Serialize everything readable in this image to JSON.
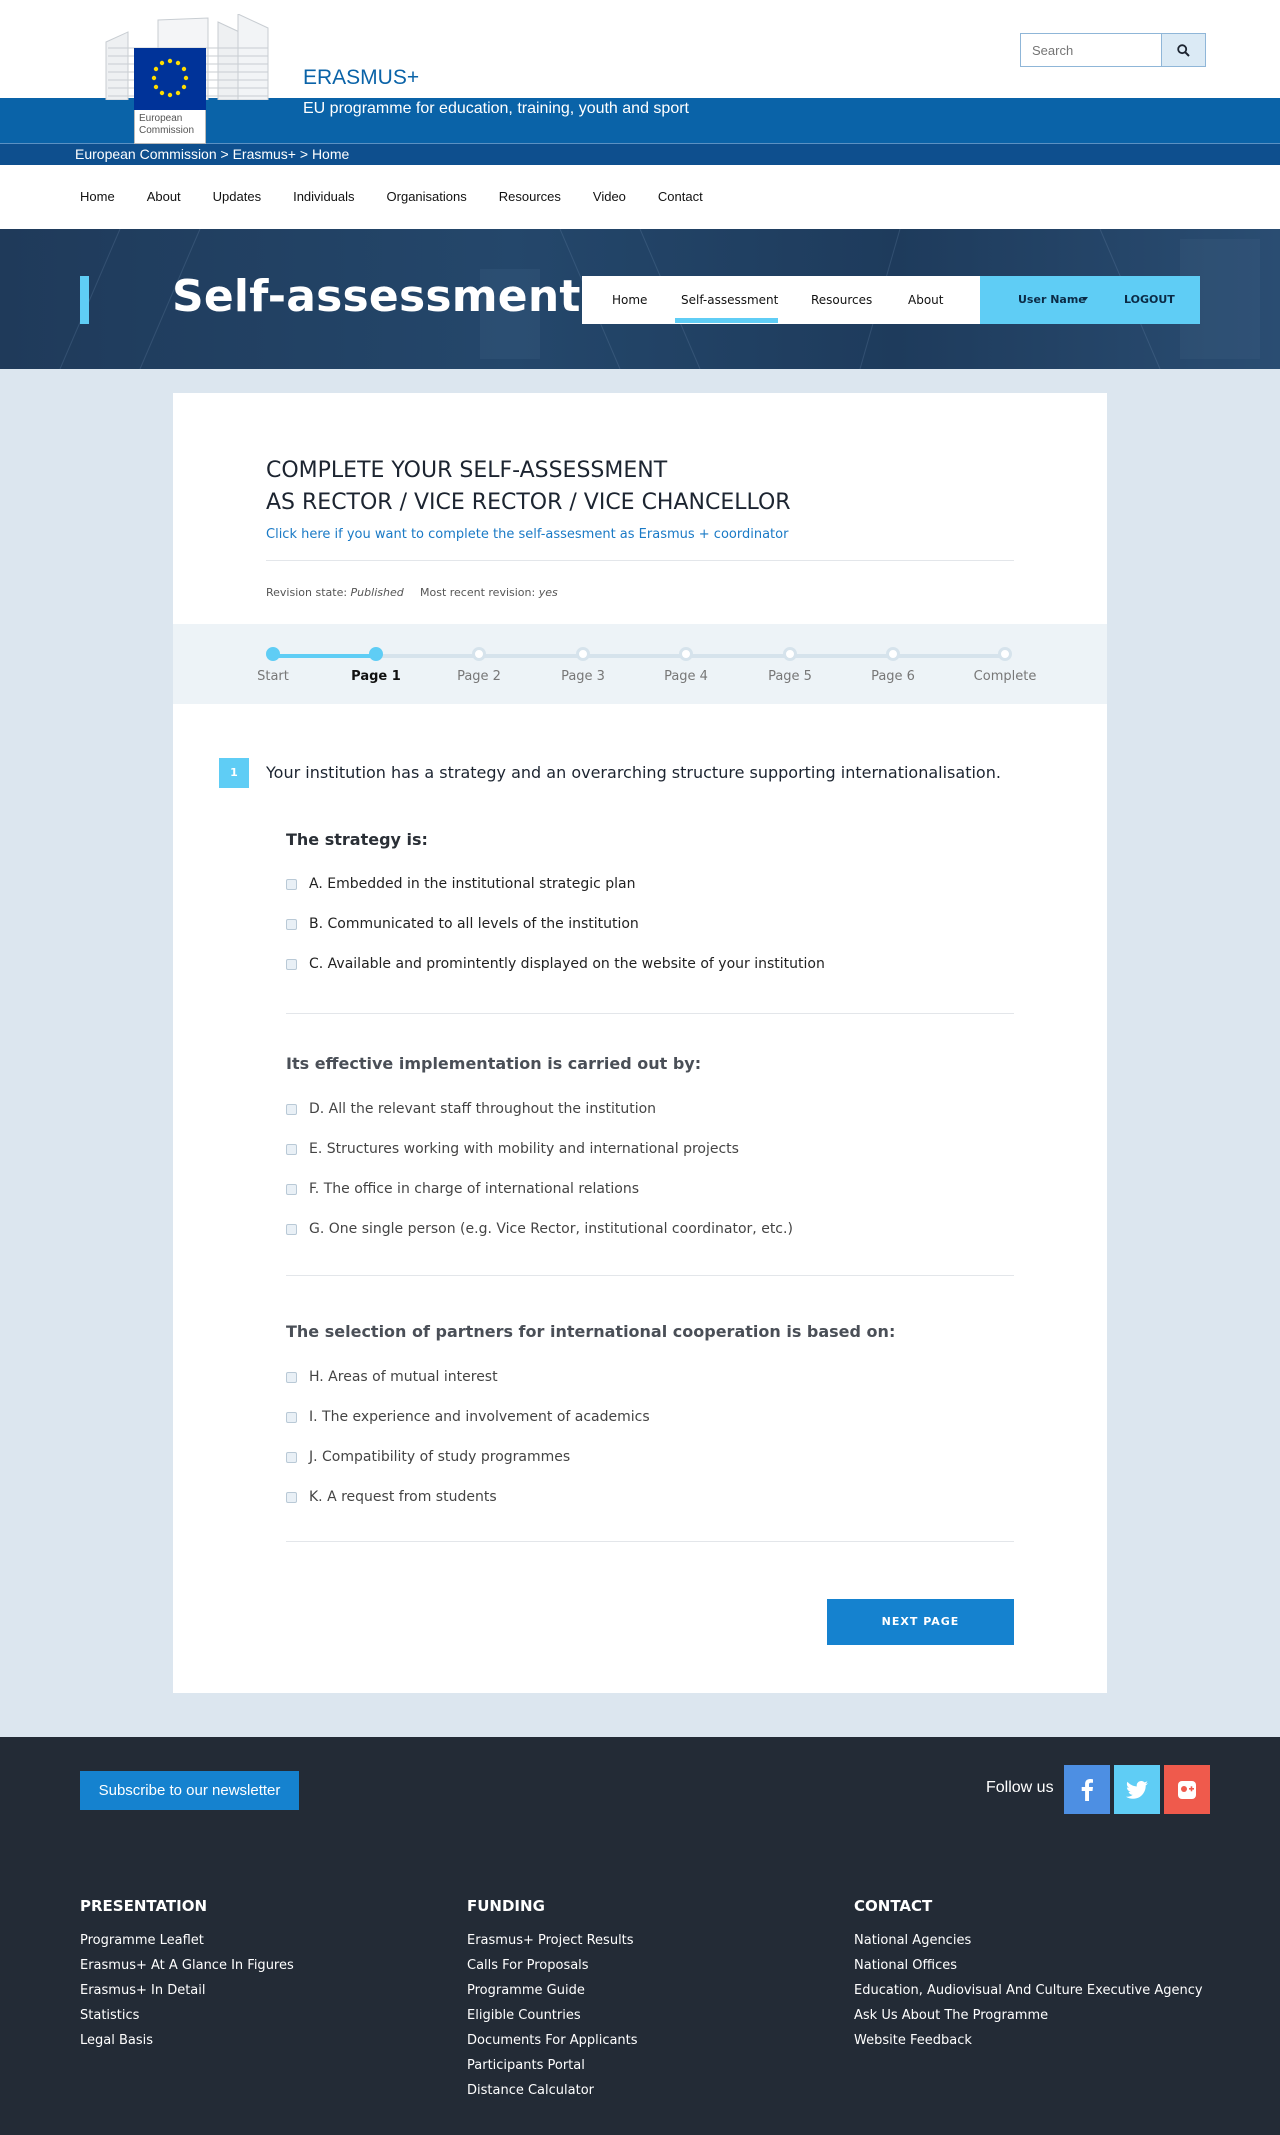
{
  "header": {
    "logo_caption": "European Commission",
    "site_title": "ERASMUS+",
    "site_subtitle": "EU programme for education, training, youth and sport",
    "breadcrumb": "European Commission > Erasmus+ > Home",
    "search_placeholder": "Search",
    "colors": {
      "brand_blue": "#0a63a8",
      "accent": "#5fcdf5"
    }
  },
  "main_nav": [
    "Home",
    "About",
    "Updates",
    "Individuals",
    "Organisations",
    "Resources",
    "Video",
    "Contact"
  ],
  "hero": {
    "title": "Self-assessment",
    "subnav": [
      "Home",
      "Self-assessment",
      "Resources",
      "About"
    ],
    "active_subnav": "Self-assessment",
    "user_name": "User Name",
    "logout": "LOGOUT"
  },
  "assessment": {
    "heading_line1": "COMPLETE YOUR SELF-ASSESSMENT",
    "heading_line2": "AS RECTOR / VICE RECTOR / VICE CHANCELLOR",
    "alt_link": "Click here if you want to complete the self-assesment as Erasmus + coordinator",
    "revision_state_label": "Revision state:",
    "revision_state_value": "Published",
    "recent_revision_label": "Most recent revision:",
    "recent_revision_value": "yes",
    "steps": [
      "Start",
      "Page 1",
      "Page 2",
      "Page 3",
      "Page 4",
      "Page 5",
      "Page 6",
      "Complete"
    ],
    "current_step": "Page 1",
    "question_number": "1",
    "question_text": "Your institution has a strategy and an overarching structure supporting internationalisation.",
    "groups": [
      {
        "title": "The strategy is:",
        "options": [
          "A. Embedded in the institutional strategic plan",
          "B. Communicated to all levels of the institution",
          "C. Available and promintently displayed on the website of your institution"
        ]
      },
      {
        "title": "Its effective implementation is carried out by:",
        "options": [
          "D. All the relevant staff throughout the institution",
          "E. Structures working with mobility and international projects",
          "F. The office in charge of international relations",
          "G. One single person (e.g. Vice Rector, institutional coordinator, etc.)"
        ]
      },
      {
        "title": "The selection of partners for international cooperation is based on:",
        "options": [
          "H. Areas of mutual interest",
          "I. The experience and involvement of academics",
          "J. Compatibility of study programmes",
          "K. A request from students"
        ]
      }
    ],
    "next_button": "NEXT PAGE"
  },
  "footer": {
    "newsletter": "Subscribe to our newsletter",
    "follow_us": "Follow us",
    "social": [
      {
        "icon": "facebook-icon",
        "color": "#4d8fe3"
      },
      {
        "icon": "twitter-icon",
        "color": "#5fcdf5"
      },
      {
        "icon": "google-plus-icon",
        "color": "#ef5a4c"
      }
    ],
    "columns": [
      {
        "title": "PRESENTATION",
        "links": [
          "Programme Leaflet",
          "Erasmus+ At A Glance In Figures",
          "Erasmus+ In Detail",
          "Statistics",
          "Legal Basis"
        ]
      },
      {
        "title": "FUNDING",
        "links": [
          "Erasmus+ Project Results",
          "Calls For Proposals",
          "Programme Guide",
          "Eligible Countries",
          "Documents For Applicants",
          "Participants Portal",
          "Distance Calculator"
        ]
      },
      {
        "title": "CONTACT",
        "links": [
          "National Agencies",
          "National Offices",
          "Education, Audiovisual And Culture Executive Agency",
          "Ask Us About The Programme",
          "Website Feedback"
        ]
      }
    ]
  }
}
